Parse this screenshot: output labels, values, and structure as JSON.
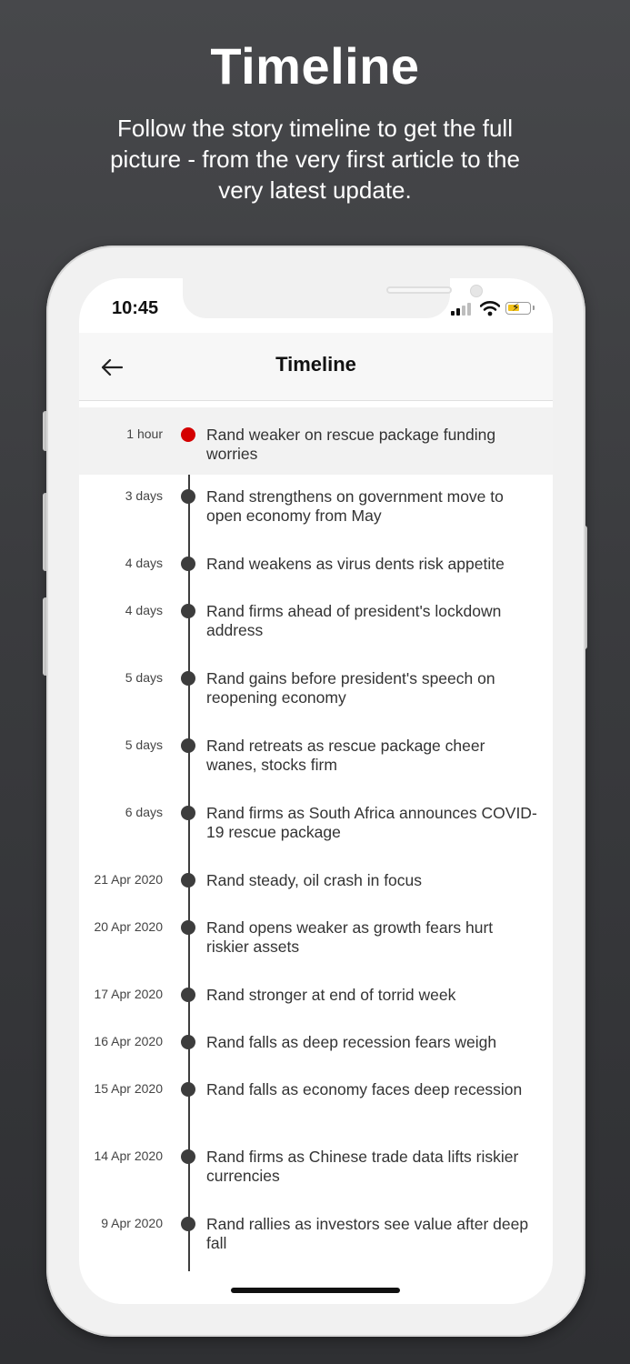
{
  "promo": {
    "title": "Timeline",
    "subtitle": "Follow the story timeline to get the full picture - from the very first article to the very latest update."
  },
  "status_bar": {
    "time": "10:45",
    "icons": [
      "signal-icon",
      "wifi-icon",
      "battery-charging-icon"
    ]
  },
  "header": {
    "back_icon": "arrow-left-icon",
    "title": "Timeline"
  },
  "colors": {
    "accent_dot": "#d40000",
    "dot": "#3d3d3d",
    "highlight_row": "#f2f2f2"
  },
  "timeline": [
    {
      "time": "1 hour",
      "title": "Rand weaker on rescue package funding worries",
      "active": true
    },
    {
      "time": "3 days",
      "title": "Rand strengthens on government move to open economy from May"
    },
    {
      "time": "4 days",
      "title": "Rand weakens as virus dents risk appetite"
    },
    {
      "time": "4 days",
      "title": "Rand firms ahead of president's lockdown address"
    },
    {
      "time": "5 days",
      "title": "Rand gains before president's speech on reopening economy"
    },
    {
      "time": "5 days",
      "title": "Rand retreats as rescue package cheer wanes, stocks firm"
    },
    {
      "time": "6 days",
      "title": "Rand firms as South Africa announces COVID-19 rescue package"
    },
    {
      "time": "21 Apr 2020",
      "title": "Rand steady, oil crash in focus"
    },
    {
      "time": "20 Apr 2020",
      "title": "Rand opens weaker as growth fears hurt riskier assets"
    },
    {
      "time": "17 Apr 2020",
      "title": "Rand stronger at end of torrid week"
    },
    {
      "time": "16 Apr 2020",
      "title": "Rand falls as deep recession fears weigh"
    },
    {
      "time": "15 Apr 2020",
      "title": "Rand falls as economy faces deep recession"
    },
    {
      "time": "14 Apr 2020",
      "title": "Rand firms as Chinese trade data lifts riskier currencies"
    },
    {
      "time": "9 Apr 2020",
      "title": "Rand rallies as investors see value after deep fall"
    }
  ]
}
